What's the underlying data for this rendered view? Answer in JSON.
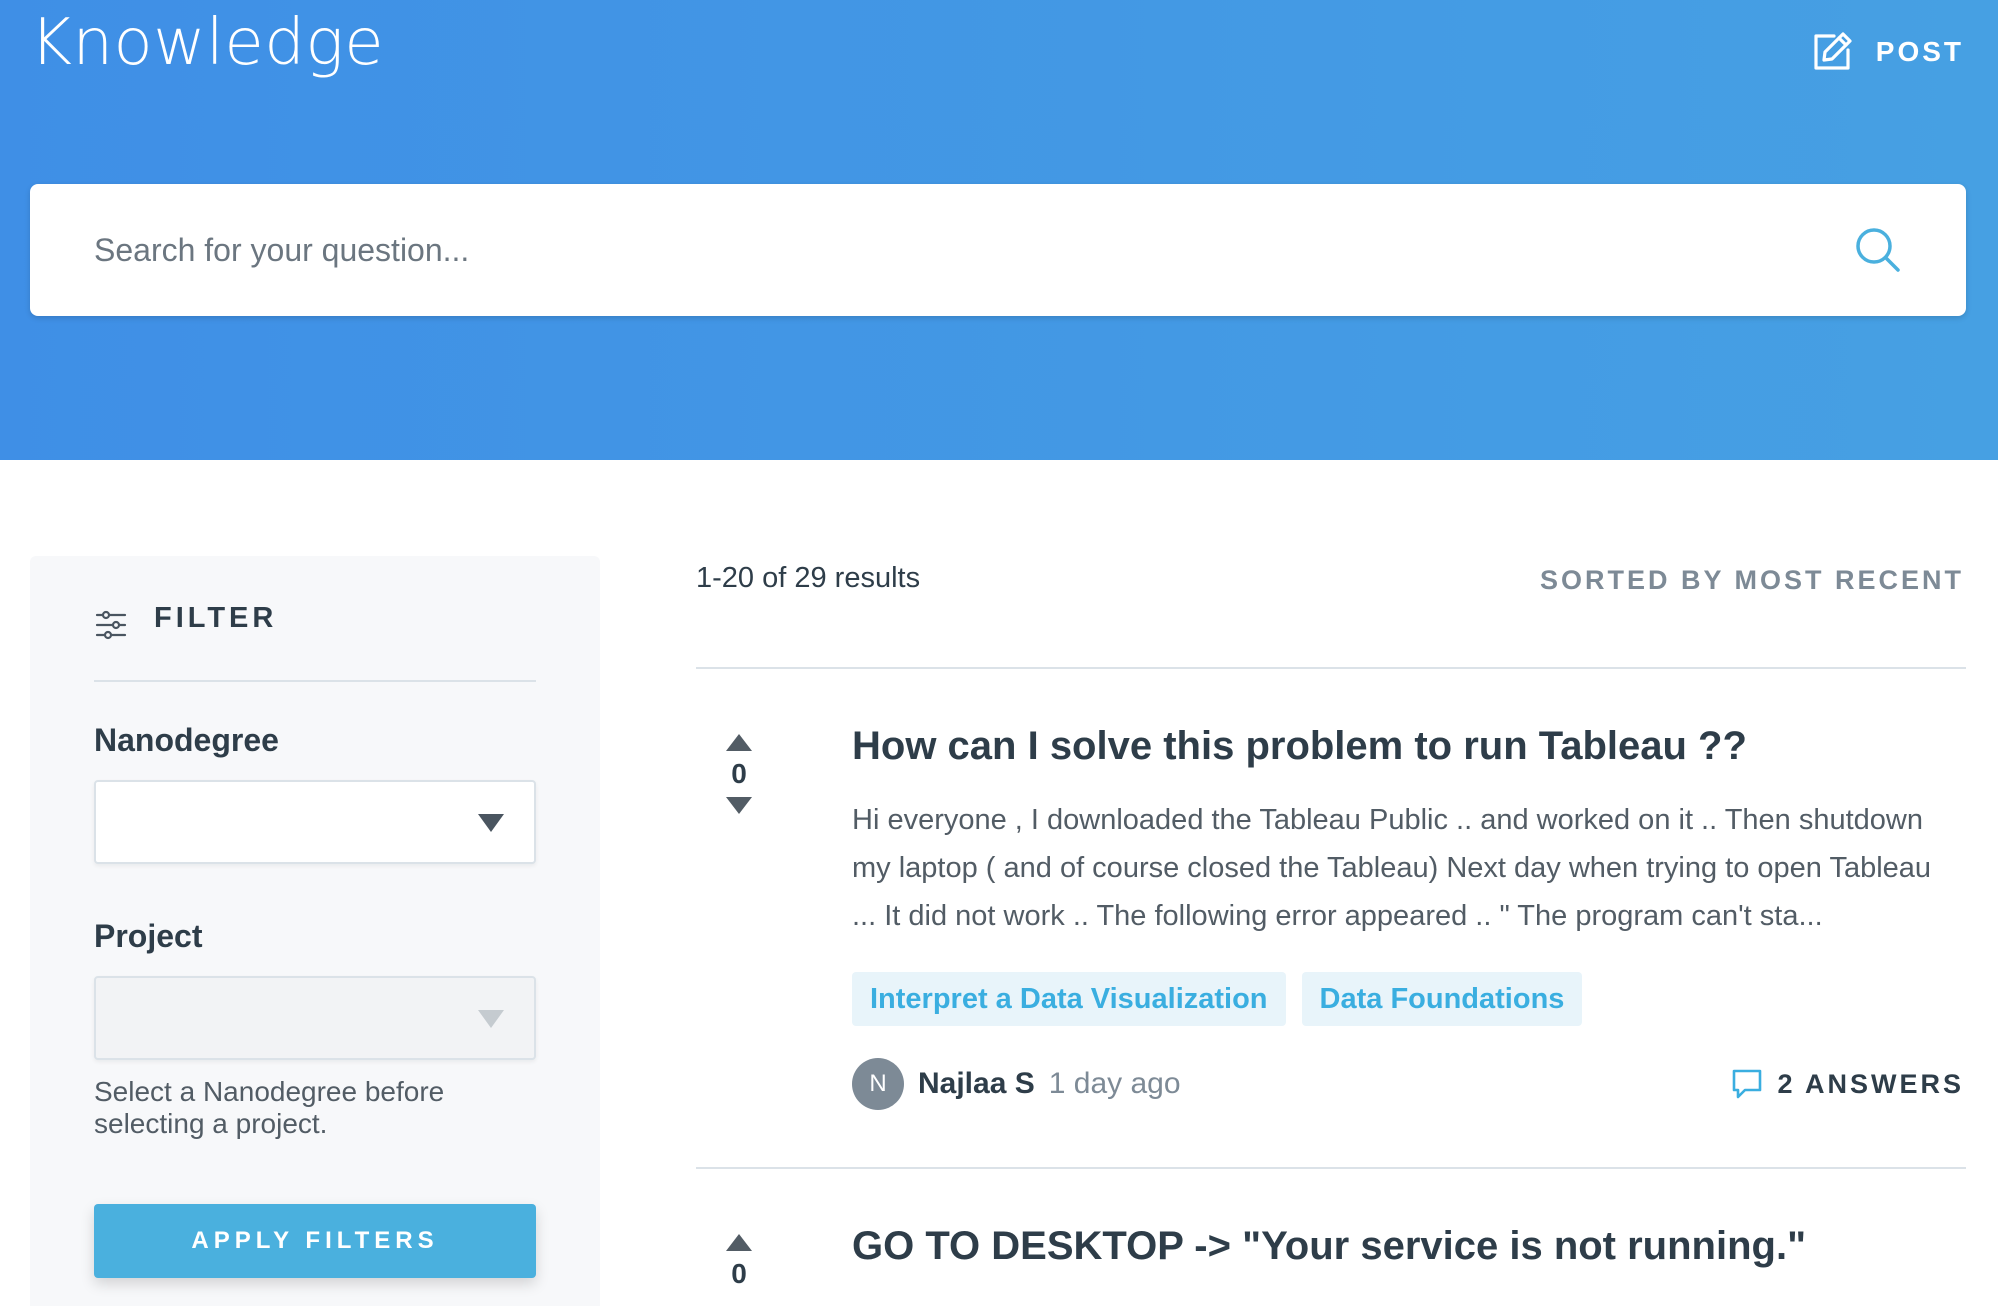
{
  "header": {
    "brand": "Knowledge",
    "post_label": "POST"
  },
  "search": {
    "placeholder": "Search for your question..."
  },
  "filter": {
    "title": "FILTER",
    "nanodegree_label": "Nanodegree",
    "nanodegree_value": "",
    "project_label": "Project",
    "project_value": "",
    "help_text": "Select a Nanodegree before selecting a project.",
    "apply_label": "APPLY FILTERS"
  },
  "results": {
    "count_text": "1-20 of 29 results",
    "sort_text": "SORTED BY MOST RECENT"
  },
  "questions": [
    {
      "votes": "0",
      "title": "How can I solve this problem to run Tableau ??",
      "excerpt": "Hi everyone , I downloaded the Tableau Public .. and worked on it .. Then shutdown my laptop ( and of course closed the Tableau) Next day when trying to open Tableau ... It did not work .. The following error appeared .. \" The program can't sta...",
      "tags": [
        "Interpret a Data Visualization",
        "Data Foundations"
      ],
      "author_initial": "N",
      "author": "Najlaa S",
      "time": "1 day ago",
      "answers": "2 ANSWERS"
    },
    {
      "votes": "0",
      "title": "GO TO DESKTOP -> \"Your service is not running.\""
    }
  ],
  "colors": {
    "hero_start": "#3f8fe6",
    "hero_end": "#46a0e3",
    "accent": "#4ab0de",
    "tag_bg": "#e8f4fa",
    "tag_text": "#3aaee0"
  }
}
